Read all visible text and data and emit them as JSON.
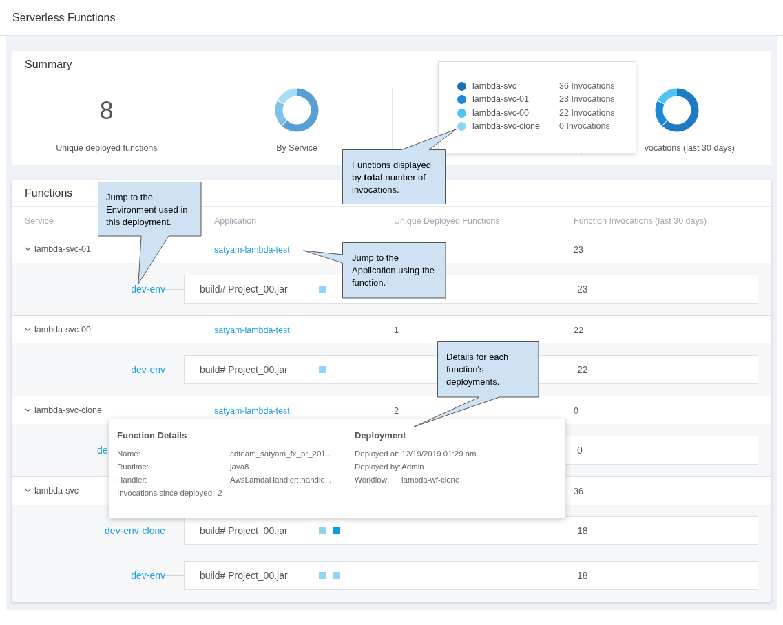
{
  "page": {
    "title": "Serverless Functions"
  },
  "summary": {
    "title": "Summary",
    "stats": [
      {
        "kind": "number",
        "value": "8",
        "label": "Unique deployed functions"
      },
      {
        "kind": "donut",
        "label": "By Service"
      },
      {
        "kind": "hidden"
      },
      {
        "kind": "donut",
        "label": "vocations (last 30 days)"
      }
    ]
  },
  "legend_popover": {
    "items": [
      {
        "name": "lambda-svc",
        "invocations": "36 Invocations",
        "color": "#1f6fba"
      },
      {
        "name": "lambda-svc-01",
        "invocations": "23 Invocations",
        "color": "#1a8ad8"
      },
      {
        "name": "lambda-svc-00",
        "invocations": "22 Invocations",
        "color": "#4fc3f7"
      },
      {
        "name": "lambda-svc-clone",
        "invocations": "0 Invocations",
        "color": "#8fd4f2"
      }
    ]
  },
  "functions": {
    "title": "Functions",
    "columns": [
      "Service",
      "Application",
      "Unique Deployed Functions",
      "Function Invocations (last 30 days)"
    ],
    "groups": [
      {
        "service": "lambda-svc-01",
        "expanded": true,
        "application": "satyam-lambda-test",
        "invocations": "23",
        "deployments": [
          {
            "environment": "dev-env",
            "build": "build# Project_00.jar",
            "invocations": "23",
            "squares": [
              {
                "selected": false
              }
            ]
          }
        ]
      },
      {
        "service": "lambda-svc-00",
        "expanded": true,
        "application": "satyam-lambda-test",
        "unique": "1",
        "invocations": "22",
        "deployments": [
          {
            "environment": "dev-env",
            "build": "build# Project_00.jar",
            "invocations": "22",
            "squares": [
              {
                "selected": false
              }
            ]
          }
        ]
      },
      {
        "service": "lambda-svc-clone",
        "expanded": true,
        "application": "satyam-lambda-test",
        "unique": "2",
        "invocations": "0",
        "deployments": [
          {
            "environment": "de",
            "covered": true,
            "invocations": "0"
          }
        ]
      },
      {
        "service": "lambda-svc",
        "expanded": true,
        "invocations": "36",
        "deployments": [
          {
            "environment": "dev-env-clone",
            "build": "build# Project_00.jar",
            "invocations": "18",
            "squares": [
              {
                "selected": false
              },
              {
                "selected": true
              }
            ]
          },
          {
            "environment": "dev-env",
            "build": "build# Project_00.jar",
            "invocations": "18",
            "squares": [
              {
                "selected": false
              },
              {
                "selected": false
              }
            ]
          }
        ]
      }
    ]
  },
  "details_popover": {
    "sections": [
      {
        "title": "Function Details",
        "fields": [
          {
            "label": "Name:",
            "value": "cdteam_satyam_fx_pr_201..."
          },
          {
            "label": "Runtime:",
            "value": "java8"
          },
          {
            "label": "Handler:",
            "value": "AwsLamdaHandler::handle..."
          },
          {
            "label": "Invocations since deployed:",
            "value": "2"
          }
        ]
      },
      {
        "title": "Deployment",
        "fields": [
          {
            "label": "Deployed at:",
            "value": "12/19/2019 01:29 am"
          },
          {
            "label": "Deployed by:",
            "value": "Admin"
          },
          {
            "label": "Workflow:",
            "value": "lambda-wf-clone"
          }
        ]
      }
    ]
  },
  "callouts": [
    {
      "text": "Functions displayed by **total** number of invocations."
    },
    {
      "text": "Jump to the Environment used in this deployment."
    },
    {
      "text": "Jump to the Application using the function."
    },
    {
      "text": "Details for each function's deployments."
    }
  ]
}
